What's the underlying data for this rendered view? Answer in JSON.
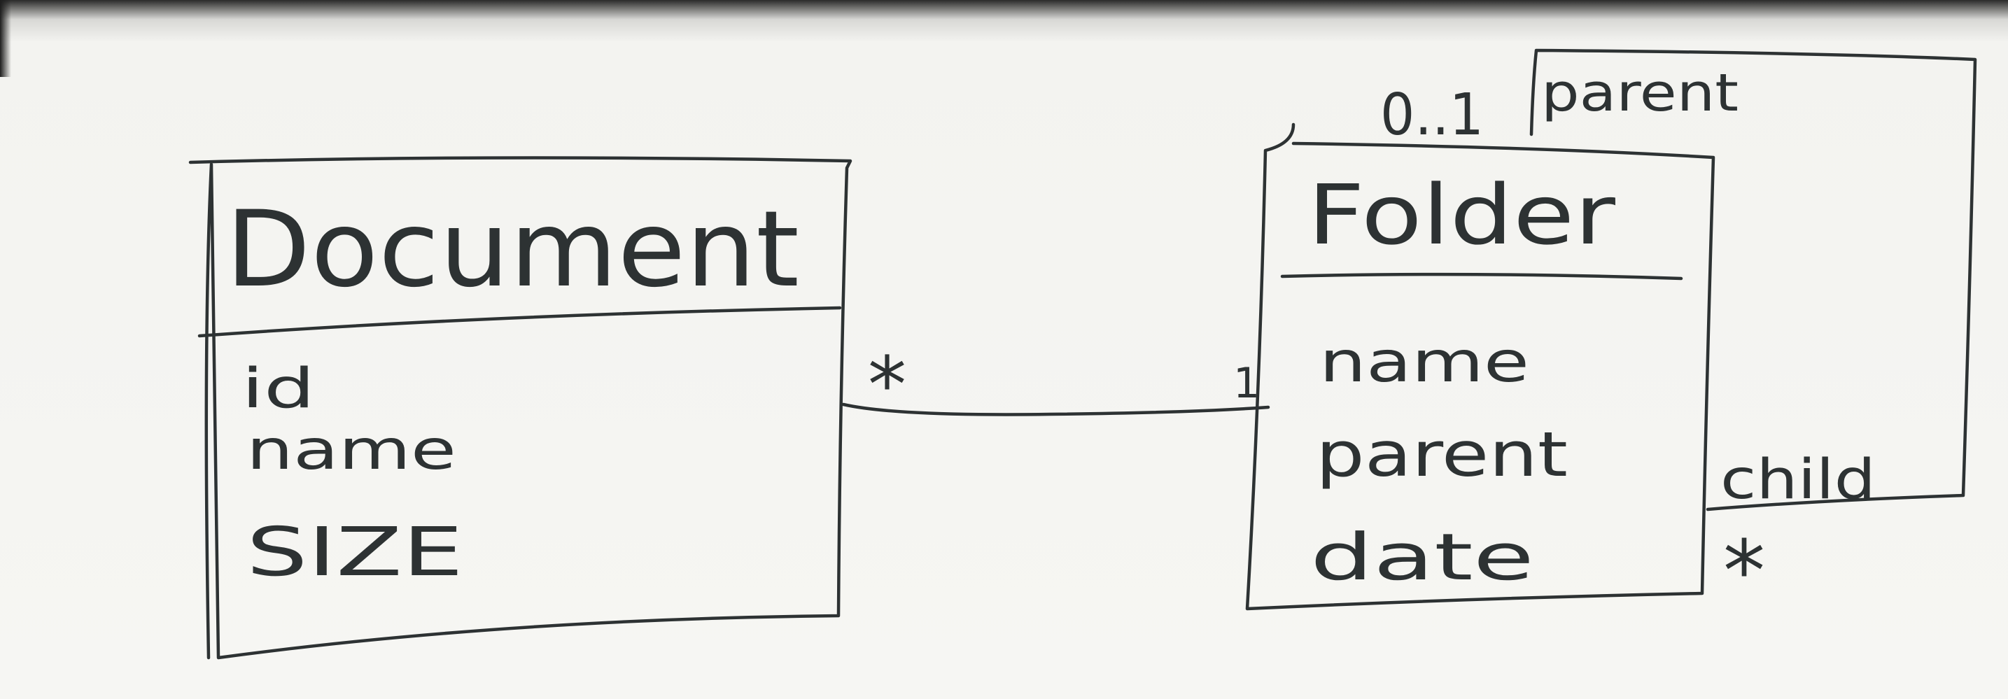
{
  "document_class": {
    "name": "Document",
    "attributes": [
      "id",
      "name",
      "SIZE"
    ]
  },
  "folder_class": {
    "name": "Folder",
    "attributes": [
      "name",
      "parent",
      "date"
    ]
  },
  "association": {
    "document_end": "*",
    "folder_end": "1"
  },
  "self_association": {
    "parent_multiplicity": "0..1",
    "parent_role": "parent",
    "child_role": "child",
    "child_multiplicity": "*"
  }
}
